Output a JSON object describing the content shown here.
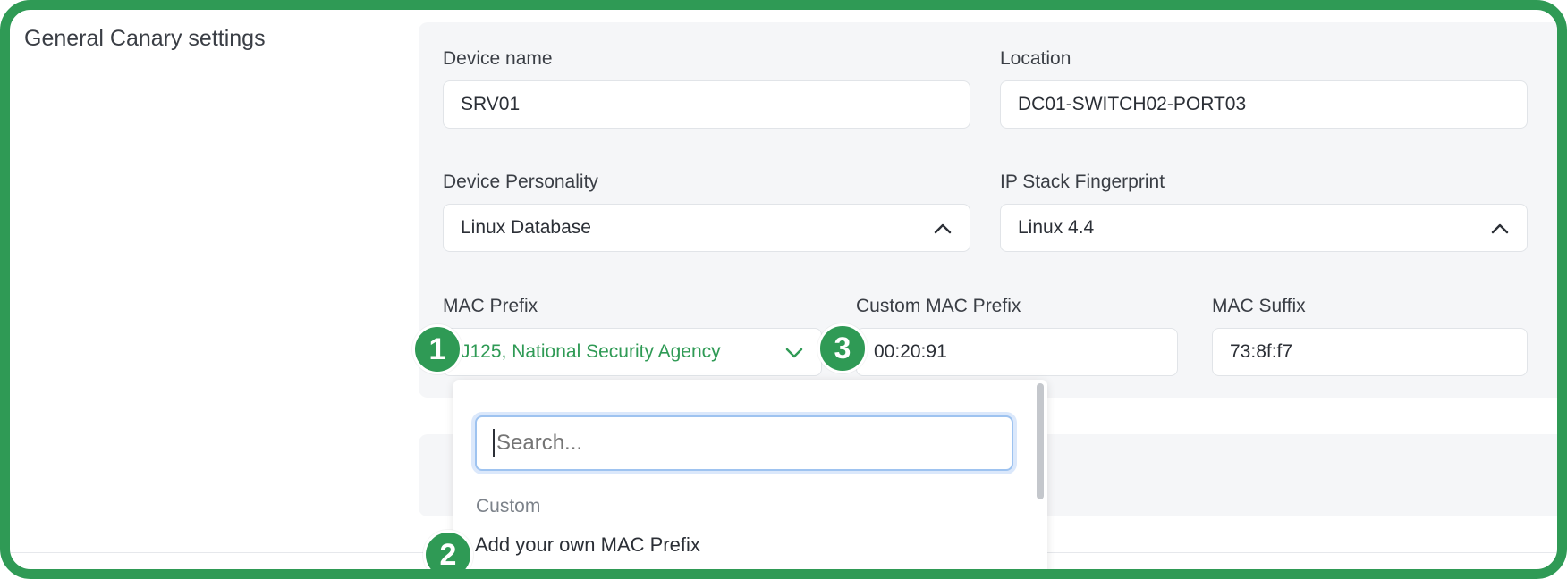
{
  "section": {
    "title": "General Canary settings"
  },
  "device_name": {
    "label": "Device name",
    "value": "SRV01"
  },
  "location": {
    "label": "Location",
    "value": "DC01-SWITCH02-PORT03"
  },
  "device_personality": {
    "label": "Device Personality",
    "value": "Linux Database"
  },
  "ip_stack": {
    "label": "IP Stack Fingerprint",
    "value": "Linux 4.4"
  },
  "mac_prefix": {
    "label": "MAC Prefix",
    "value": "J125, National Security Agency"
  },
  "custom_mac_prefix": {
    "label": "Custom MAC Prefix",
    "value": "00:20:91"
  },
  "mac_suffix": {
    "label": "MAC Suffix",
    "value": "73:8f:f7"
  },
  "dropdown": {
    "search_placeholder": "Search...",
    "group_label": "Custom",
    "option_add": "Add your own MAC Prefix"
  },
  "badges": [
    "1",
    "2",
    "3"
  ],
  "colors": {
    "accent": "#2f9a55",
    "focus_ring": "#9ec3f0",
    "panel_bg": "#f5f6f8"
  },
  "icons": {
    "select_open": "chevron-up-icon",
    "select_closed": "chevron-down-icon"
  }
}
